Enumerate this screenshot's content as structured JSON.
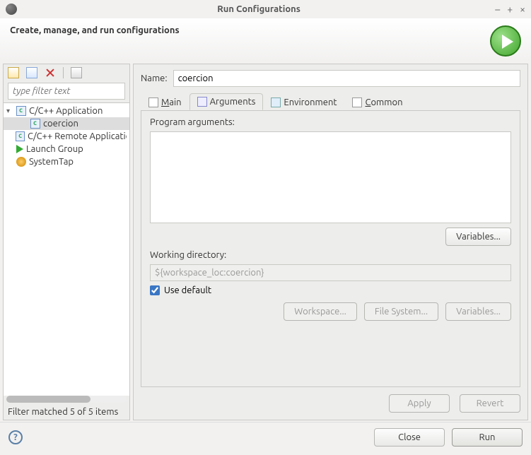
{
  "titlebar": {
    "title": "Run Configurations"
  },
  "header": {
    "title": "Create, manage, and run configurations",
    "sub": ""
  },
  "left": {
    "filter_placeholder": "type filter text",
    "tree": {
      "cpp_app": "C/C++ Application",
      "coercion": "coercion",
      "cpp_remote": "C/C++ Remote Application",
      "launch_group": "Launch Group",
      "systemtap": "SystemTap"
    },
    "status": "Filter matched 5 of 5 items"
  },
  "right": {
    "name_label": "Name:",
    "name_value": "coercion",
    "tabs": {
      "main": "Main",
      "arguments": "Arguments",
      "environment": "Environment",
      "common": "Common"
    },
    "prog_args_label": "Program arguments:",
    "prog_args_value": "",
    "variables_btn": "Variables...",
    "workdir_label": "Working directory:",
    "workdir_value": "${workspace_loc:coercion}",
    "use_default_label": "Use default",
    "use_default_checked": true,
    "workspace_btn": "Workspace...",
    "filesystem_btn": "File System...",
    "variables2_btn": "Variables...",
    "apply_btn": "Apply",
    "revert_btn": "Revert"
  },
  "footer": {
    "close_btn": "Close",
    "run_btn": "Run"
  }
}
